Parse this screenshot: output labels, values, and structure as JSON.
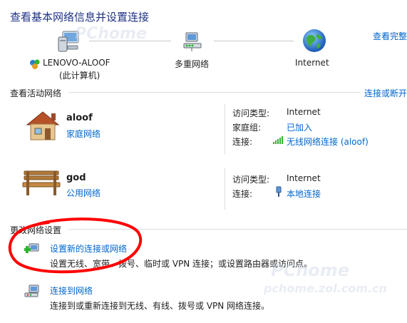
{
  "header": {
    "title": "查看基本网络信息并设置连接",
    "view_full_map": "查看完整"
  },
  "network_map": {
    "computer_name": "LENOVO-ALOOF",
    "computer_subtitle": "(此计算机)",
    "middle_label": "多重网络",
    "internet_label": "Internet"
  },
  "active_networks": {
    "section_label": "查看活动网络",
    "connect_disconnect": "连接或断开",
    "networks": [
      {
        "name": "aloof",
        "type_link": "家庭网络",
        "access_type_label": "访问类型:",
        "access_type_value": "Internet",
        "homegroup_label": "家庭组:",
        "homegroup_value": "已加入",
        "connection_label": "连接:",
        "connection_value": "无线网络连接 (aloof)"
      },
      {
        "name": "god",
        "type_link": "公用网络",
        "access_type_label": "访问类型:",
        "access_type_value": "Internet",
        "connection_label": "连接:",
        "connection_value": "本地连接"
      }
    ]
  },
  "change_settings": {
    "section_label": "更改网络设置",
    "tasks": [
      {
        "link": "设置新的连接或网络",
        "description": "设置无线、宽带、拨号、临时或 VPN 连接；或设置路由器或访问点。"
      },
      {
        "link": "连接到网络",
        "description": "连接到或重新连接到无线、有线、拨号或 VPN 网络连接。"
      }
    ]
  },
  "watermark": {
    "text_1": "PChome",
    "text_2": "pchome.zol.com.cn"
  },
  "colors": {
    "link": "#0066cc",
    "title": "#1e3287",
    "annotation_red": "#ff0000",
    "divider": "#dcdcdc"
  }
}
